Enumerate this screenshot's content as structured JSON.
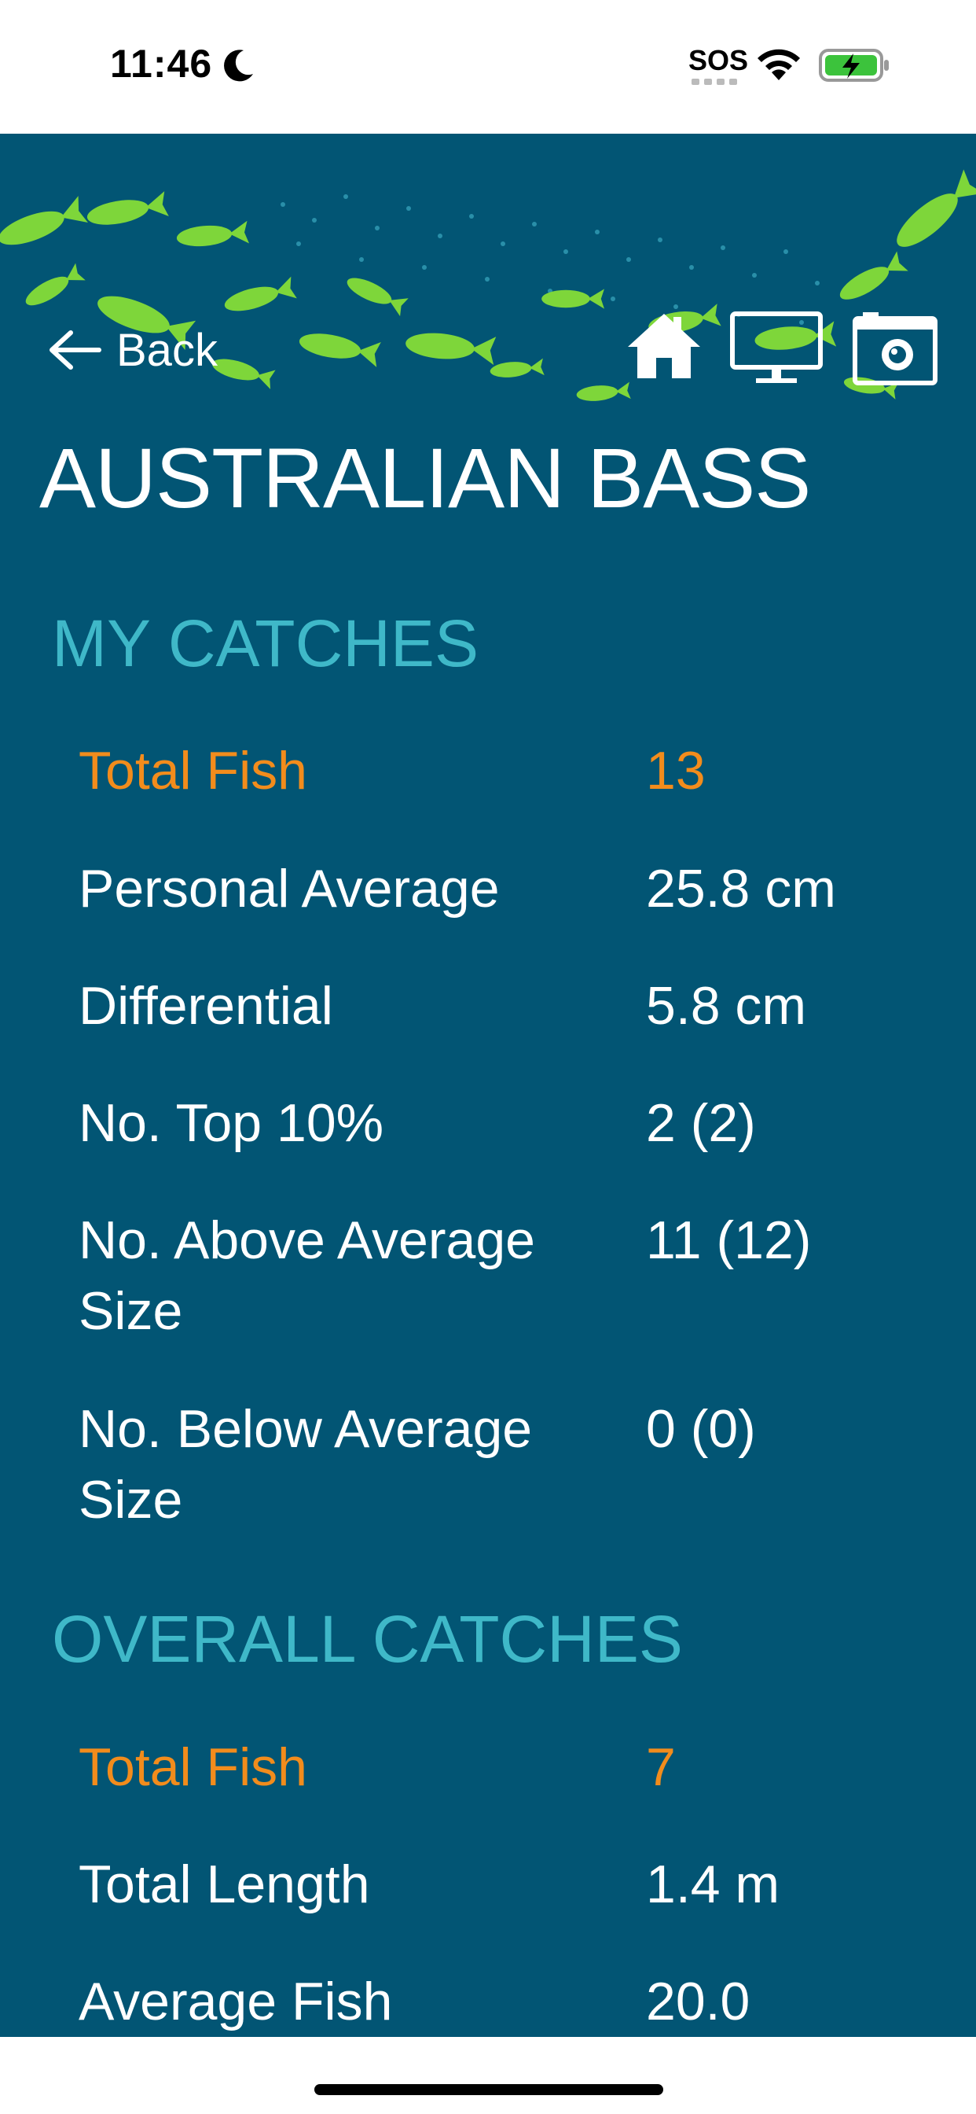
{
  "status_bar": {
    "time": "11:46",
    "sos": "SOS",
    "icons": [
      "moon-icon",
      "wifi-icon",
      "battery-charging-icon"
    ]
  },
  "nav": {
    "back_label": "Back",
    "icons": [
      "arrow-left-icon",
      "home-icon",
      "monitor-icon",
      "camera-icon"
    ]
  },
  "species": {
    "title": "AUSTRALIAN BASS"
  },
  "my_catches": {
    "heading": "MY CATCHES",
    "rows": [
      {
        "label": "Total Fish",
        "value": "13"
      },
      {
        "label": "Personal Average",
        "value": "25.8 cm"
      },
      {
        "label": "Differential",
        "value": "5.8 cm"
      },
      {
        "label": "No. Top 10%",
        "value": "2 (2)"
      },
      {
        "label": "No. Above Average Size",
        "value": "11 (12)"
      },
      {
        "label": "No. Below Average Size",
        "value": "0 (0)"
      }
    ]
  },
  "overall_catches": {
    "heading": "OVERALL CATCHES",
    "rows": [
      {
        "label": "Total Fish",
        "value": "7"
      },
      {
        "label": "Total Length",
        "value": "1.4 m"
      },
      {
        "label": "Average Fish",
        "value": "20.0"
      }
    ]
  },
  "colors": {
    "background": "#025574",
    "section_heading": "#3fb8c8",
    "highlight": "#f28c1c",
    "fish_green": "#7ed63a"
  }
}
